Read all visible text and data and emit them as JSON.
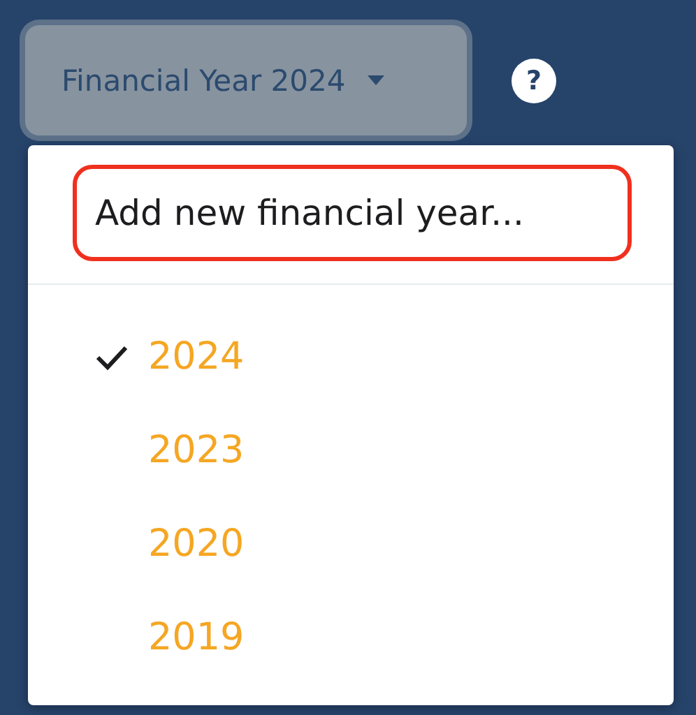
{
  "year_button": {
    "label": "Financial Year 2024"
  },
  "help": {
    "label": "?"
  },
  "menu": {
    "add_item": {
      "label": "Add new financial year...",
      "highlighted": true
    },
    "years": [
      {
        "label": "2024",
        "selected": true
      },
      {
        "label": "2023",
        "selected": false
      },
      {
        "label": "2020",
        "selected": false
      },
      {
        "label": "2019",
        "selected": false
      }
    ]
  }
}
